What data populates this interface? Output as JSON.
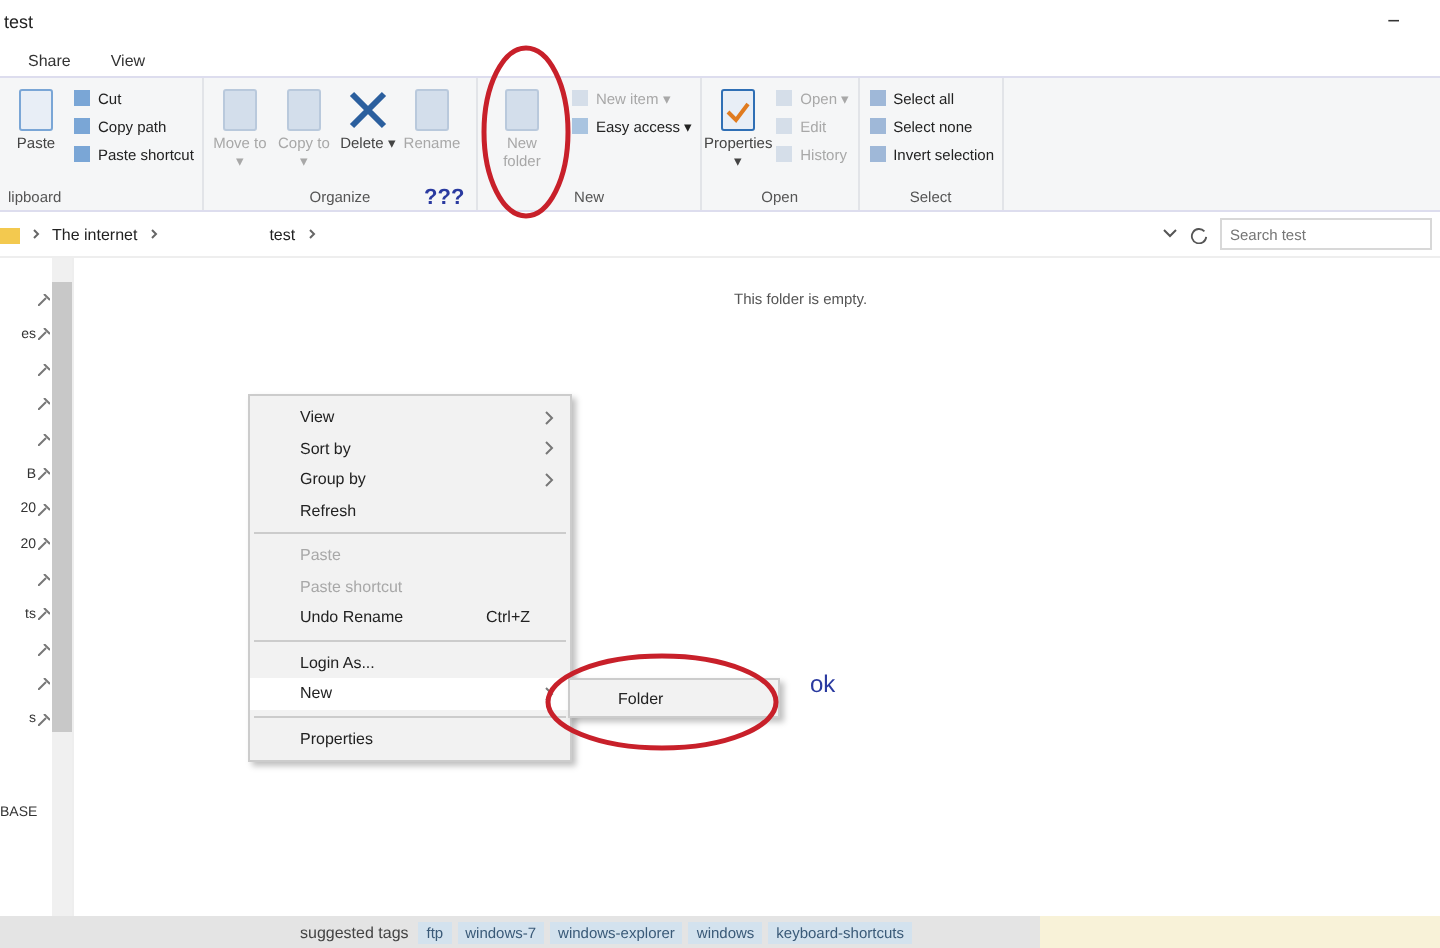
{
  "window": {
    "title": "test",
    "minimize": "−"
  },
  "tabs": [
    {
      "label": "Share",
      "selected": false
    },
    {
      "label": "View",
      "selected": false
    }
  ],
  "ribbon": [
    {
      "label": "lipboard",
      "items": [
        {
          "label": "Paste",
          "kind": "large",
          "disabled": false
        },
        {
          "label": "Cut",
          "kind": "small",
          "disabled": false
        },
        {
          "label": "Copy path",
          "kind": "small",
          "disabled": false
        },
        {
          "label": "Paste shortcut",
          "kind": "small",
          "disabled": false
        }
      ]
    },
    {
      "label": "Organize",
      "items": [
        {
          "label": "Move to ▾",
          "kind": "large",
          "disabled": true
        },
        {
          "label": "Copy to ▾",
          "kind": "large",
          "disabled": true
        },
        {
          "label": "Delete ▾",
          "kind": "large",
          "disabled": false
        },
        {
          "label": "Rename",
          "kind": "large",
          "disabled": true
        }
      ]
    },
    {
      "label": "New",
      "items": [
        {
          "label": "New folder",
          "kind": "large",
          "disabled": true
        },
        {
          "label": "New item ▾",
          "kind": "small",
          "disabled": true
        },
        {
          "label": "Easy access ▾",
          "kind": "small",
          "disabled": false
        }
      ]
    },
    {
      "label": "Open",
      "items": [
        {
          "label": "Properties ▾",
          "kind": "large",
          "disabled": false
        },
        {
          "label": "Open ▾",
          "kind": "small",
          "disabled": true
        },
        {
          "label": "Edit",
          "kind": "small",
          "disabled": true
        },
        {
          "label": "History",
          "kind": "small",
          "disabled": true
        }
      ]
    },
    {
      "label": "Select",
      "items": [
        {
          "label": "Select all",
          "kind": "small",
          "disabled": false
        },
        {
          "label": "Select none",
          "kind": "small",
          "disabled": false
        },
        {
          "label": "Invert selection",
          "kind": "small",
          "disabled": false
        }
      ]
    }
  ],
  "address": {
    "crumbs": [
      "The internet",
      "test"
    ],
    "search": {
      "placeholder": "Search test"
    }
  },
  "nav_pane": [
    {
      "pinned": true
    },
    {
      "label": "es",
      "pinned": true
    },
    {
      "pinned": true
    },
    {
      "pinned": true
    },
    {
      "pinned": true
    },
    {
      "label": "B",
      "pinned": true
    },
    {
      "label": "20",
      "pinned": true
    },
    {
      "label": "20",
      "pinned": true
    },
    {
      "pinned": true
    },
    {
      "label": "ts",
      "pinned": true
    },
    {
      "pinned": true
    },
    {
      "pinned": true
    },
    {
      "label": "s",
      "pinned": true
    }
  ],
  "nav_bottom": "BASE",
  "empty_message": "This folder is empty.",
  "context_menu": [
    {
      "label": "View",
      "kind": "submenu",
      "disabled": false,
      "selected": false
    },
    {
      "label": "Sort by",
      "kind": "submenu",
      "disabled": false,
      "selected": false
    },
    {
      "label": "Group by",
      "kind": "submenu",
      "disabled": false,
      "selected": false
    },
    {
      "label": "Refresh",
      "kind": "item",
      "disabled": false,
      "selected": false
    },
    {
      "kind": "separator"
    },
    {
      "label": "Paste",
      "kind": "item",
      "disabled": true,
      "selected": false
    },
    {
      "label": "Paste shortcut",
      "kind": "item",
      "disabled": true,
      "selected": false
    },
    {
      "label": "Undo Rename",
      "kind": "item",
      "disabled": false,
      "selected": false,
      "shortcut": "Ctrl+Z"
    },
    {
      "kind": "separator"
    },
    {
      "label": "Login As...",
      "kind": "item",
      "disabled": false,
      "selected": false
    },
    {
      "label": "New",
      "kind": "submenu",
      "disabled": false,
      "selected": true
    },
    {
      "kind": "separator"
    },
    {
      "label": "Properties",
      "kind": "item",
      "disabled": false,
      "selected": false
    }
  ],
  "submenu": [
    {
      "label": "Folder"
    }
  ],
  "annotations": [
    {
      "text": "???"
    },
    {
      "text": "ok"
    }
  ],
  "tags_bar": {
    "label": "suggested tags",
    "tags": [
      "ftp",
      "windows-7",
      "windows-explorer",
      "windows",
      "keyboard-shortcuts"
    ]
  }
}
